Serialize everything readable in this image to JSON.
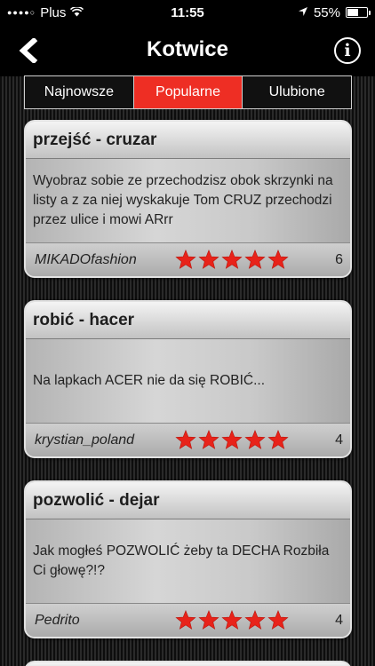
{
  "status_bar": {
    "carrier": "Plus",
    "time": "11:55",
    "battery": "55%",
    "battery_level": 55
  },
  "nav": {
    "title": "Kotwice"
  },
  "tabs": [
    {
      "label": "Najnowsze",
      "active": false
    },
    {
      "label": "Popularne",
      "active": true
    },
    {
      "label": "Ulubione",
      "active": false
    }
  ],
  "cards": [
    {
      "title": "przejść - cruzar",
      "text": "Wyobraz sobie ze przechodzisz obok skrzynki na listy a z za niej wyskakuje Tom CRUZ przechodzi przez ulice i mowi ARrr",
      "author": "MIKADOfashion",
      "rating": 5,
      "votes": "6"
    },
    {
      "title": "robić - hacer",
      "text": "Na lapkach ACER nie da się ROBIĆ...",
      "author": "krystian_poland",
      "rating": 5,
      "votes": "4"
    },
    {
      "title": "pozwolić - dejar",
      "text": "Jak mogłeś POZWOLIĆ żeby ta DECHA Rozbiła Ci głowę?!?",
      "author": "Pedrito",
      "rating": 5,
      "votes": "4"
    }
  ],
  "colors": {
    "accent": "#ee2e24",
    "star": "#e8231a"
  },
  "icons": {
    "back": "chevron-left-icon",
    "info": "info-icon",
    "star": "star-icon",
    "location": "location-arrow-icon",
    "wifi": "wifi-icon"
  }
}
